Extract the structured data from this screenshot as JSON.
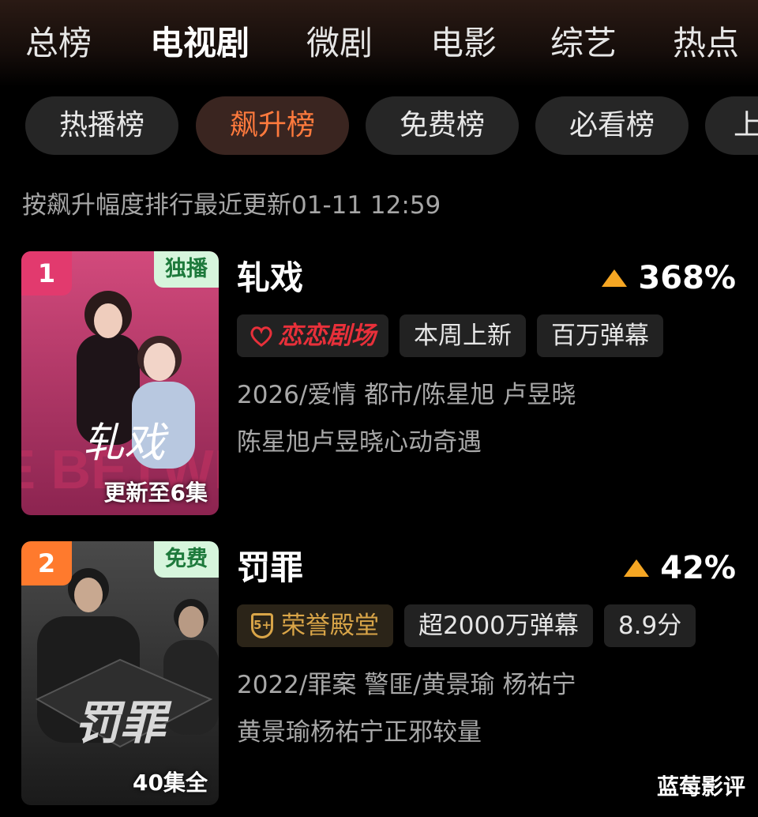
{
  "top_tabs": [
    {
      "label": "总榜",
      "active": false
    },
    {
      "label": "电视剧",
      "active": true
    },
    {
      "label": "微剧",
      "active": false
    },
    {
      "label": "电影",
      "active": false
    },
    {
      "label": "综艺",
      "active": false
    },
    {
      "label": "热点",
      "active": false
    }
  ],
  "sub_tabs": [
    {
      "label": "热播榜",
      "active": false
    },
    {
      "label": "飙升榜",
      "active": true
    },
    {
      "label": "免费榜",
      "active": false
    },
    {
      "label": "必看榜",
      "active": false
    },
    {
      "label": "上",
      "active": false
    }
  ],
  "subtitle": "按飙升幅度排行最近更新01-11 12:59",
  "items": [
    {
      "rank": "1",
      "rank_color": "#e23a6e",
      "corner_tag": "独播",
      "episode_status": "更新至6集",
      "poster_title": "轧戏",
      "poster_bg_text": "LIVE BETWEEN",
      "title": "轧戏",
      "heat": "368%",
      "badges": [
        {
          "type": "brand",
          "label": "恋恋剧场",
          "icon": "heart-icon"
        },
        {
          "type": "normal",
          "label": "本周上新"
        },
        {
          "type": "normal",
          "label": "百万弹幕"
        }
      ],
      "meta": "2026/爱情 都市/陈星旭 卢昱晓",
      "desc": "陈星旭卢昱晓心动奇遇"
    },
    {
      "rank": "2",
      "rank_color": "#ff7a2d",
      "corner_tag": "免费",
      "episode_status": "40集全",
      "poster_title": "罚罪",
      "title": "罚罪",
      "heat": "42%",
      "badges": [
        {
          "type": "honor",
          "label": "荣誉殿堂",
          "icon": "shield-5-icon",
          "icon_text": "5+"
        },
        {
          "type": "normal",
          "label": "超2000万弹幕"
        },
        {
          "type": "normal",
          "label": "8.9分"
        }
      ],
      "meta": "2022/罪案 警匪/黄景瑜 杨祐宁",
      "desc": "黄景瑜杨祐宁正邪较量"
    }
  ],
  "watermark": "蓝莓影评",
  "colors": {
    "accent": "#ff7a3d",
    "heat_arrow": "#f5a623",
    "tag_green": "#d6f5dc",
    "brand_red": "#e8303a",
    "honor_gold": "#d9a548"
  }
}
